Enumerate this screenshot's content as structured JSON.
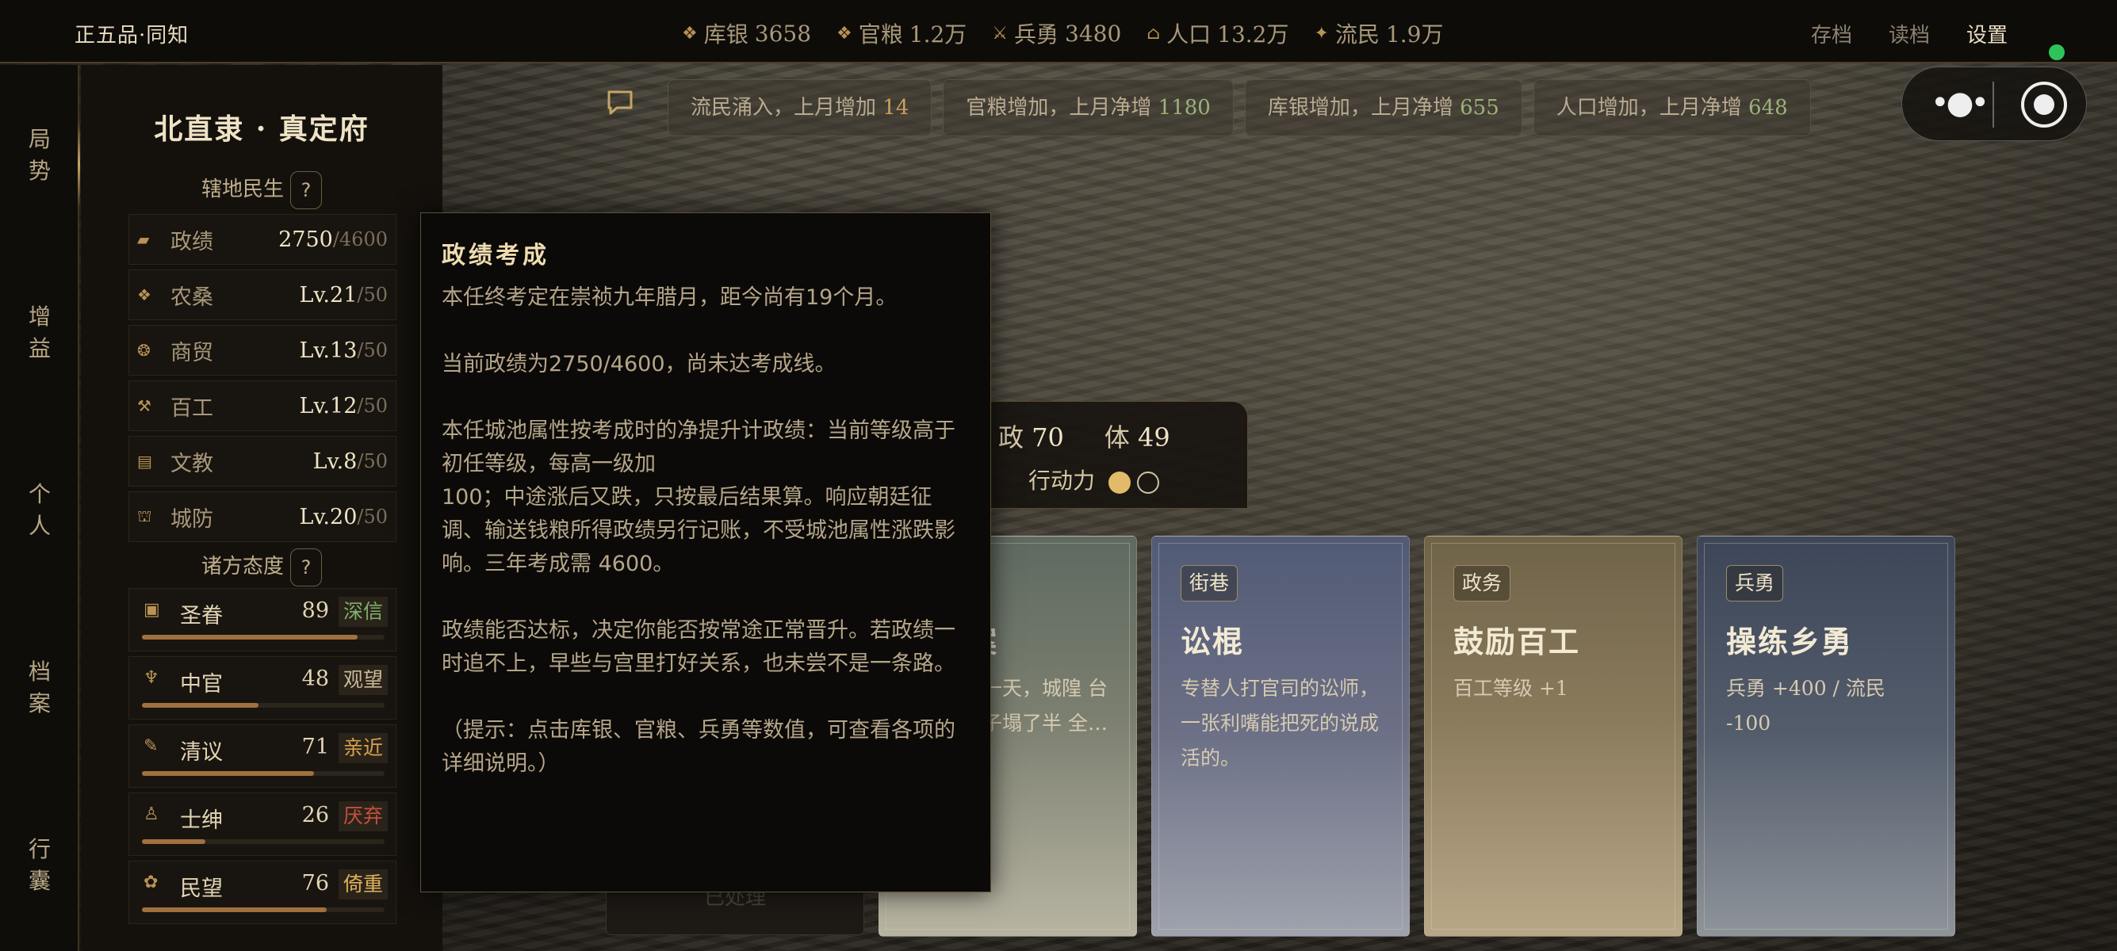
{
  "topbar": {
    "rank": "正五品·同知",
    "resources": [
      {
        "icon": "silver-icon",
        "label": "库银",
        "value": "3658"
      },
      {
        "icon": "grain-icon",
        "label": "官粮",
        "value": "1.2万"
      },
      {
        "icon": "soldier-icon",
        "label": "兵勇",
        "value": "3480"
      },
      {
        "icon": "population-icon",
        "label": "人口",
        "value": "13.2万"
      },
      {
        "icon": "refugee-icon",
        "label": "流民",
        "value": "1.9万"
      }
    ],
    "menus": {
      "save": "存档",
      "load": "读档",
      "settings": "设置"
    },
    "status_color": "#2ec35a"
  },
  "leftnav": [
    "局势",
    "增益",
    "个人",
    "档案",
    "行囊"
  ],
  "panel": {
    "prefecture": "北直隶 · 真定府",
    "section1": "辖地民生",
    "help": "?",
    "stats": [
      {
        "icon": "merit-icon",
        "name": "政绩",
        "value": "2750",
        "max": "/4600"
      },
      {
        "icon": "agriculture-icon",
        "name": "农桑",
        "value": "Lv.21",
        "max": "/50"
      },
      {
        "icon": "trade-icon",
        "name": "商贸",
        "value": "Lv.13",
        "max": "/50"
      },
      {
        "icon": "crafts-icon",
        "name": "百工",
        "value": "Lv.12",
        "max": "/50"
      },
      {
        "icon": "education-icon",
        "name": "文教",
        "value": "Lv.8",
        "max": "/50"
      },
      {
        "icon": "defense-icon",
        "name": "城防",
        "value": "Lv.20",
        "max": "/50"
      }
    ],
    "section2": "诸方态度",
    "attitudes": [
      {
        "icon": "emperor-icon",
        "name": "圣眷",
        "value": "89",
        "badge": "深信",
        "badge_color": "#7fb06a",
        "bar": 0.89
      },
      {
        "icon": "eunuch-icon",
        "name": "中官",
        "value": "48",
        "badge": "观望",
        "badge_color": "#c9b99a",
        "bar": 0.48
      },
      {
        "icon": "scholar-icon",
        "name": "清议",
        "value": "71",
        "badge": "亲近",
        "badge_color": "#d8a24e",
        "bar": 0.71
      },
      {
        "icon": "gentry-icon",
        "name": "士绅",
        "value": "26",
        "badge": "厌弃",
        "badge_color": "#c4503c",
        "bar": 0.26
      },
      {
        "icon": "people-icon",
        "name": "民望",
        "value": "76",
        "badge": "倚重",
        "badge_color": "#e0b25a",
        "bar": 0.76
      }
    ]
  },
  "news": [
    {
      "text": "流民涌入，上月增加",
      "num": "14",
      "num_color": "#c9a25a"
    },
    {
      "text": "官粮增加，上月净增",
      "num": "1180",
      "num_color": "#9bb27a"
    },
    {
      "text": "库银增加，上月净增",
      "num": "655",
      "num_color": "#9bb27a"
    },
    {
      "text": "人口增加，上月净增",
      "num": "648",
      "num_color": "#9bb27a"
    }
  ],
  "statbox": {
    "gov_label": "政",
    "gov": "70",
    "body_label": "体",
    "body": "49",
    "ap_label": "行动力",
    "ap_full": 1,
    "ap_total": 2
  },
  "cards": [
    {
      "tag": "",
      "title": "",
      "desc": "",
      "label": "已处理"
    },
    {
      "tag": "",
      "title": "案",
      "desc": "一天，城隍 台子塌了半 全…"
    },
    {
      "tag": "街巷",
      "title": "讼棍",
      "desc": "专替人打官司的讼师，一张利嘴能把死的说成活的。"
    },
    {
      "tag": "政务",
      "title": "鼓励百工",
      "desc": "百工等级 +1"
    },
    {
      "tag": "兵勇",
      "title": "操练乡勇",
      "desc": "兵勇 +400 / 流民 -100"
    }
  ],
  "tooltip": {
    "title": "政绩考成",
    "paras": [
      "本任终考定在崇祯九年腊月，距今尚有19个月。",
      "当前政绩为2750/4600，尚未达考成线。",
      "本任城池属性按考成时的净提升计政绩：当前等级高于初任等级，每高一级加\n100；中途涨后又跌，只按最后结果算。响应朝廷征调、输送钱粮所得政绩另行记账，不受城池属性涨跌影响。三年考成需 4600。",
      "政绩能否达标，决定你能否按常途正常晋升。若政绩一时追不上，早些与宫里打好关系，也未尝不是一条路。",
      "（提示：点击库银、官粮、兵勇等数值，可查看各项的详细说明。）"
    ]
  }
}
